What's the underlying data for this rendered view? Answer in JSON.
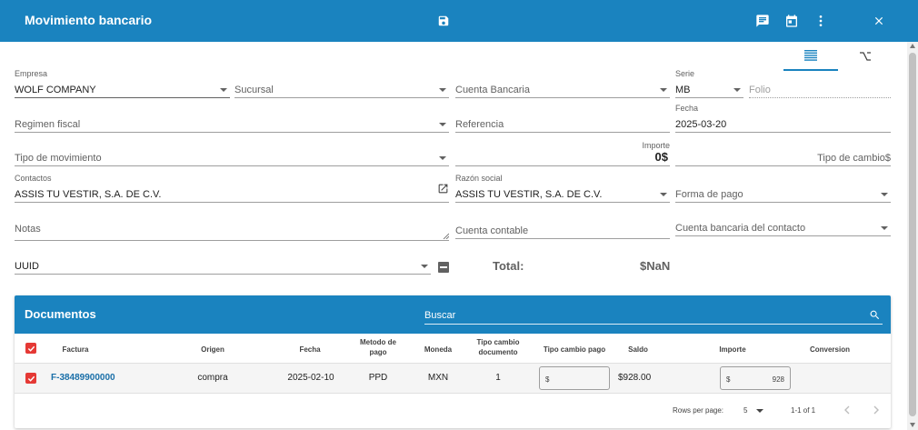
{
  "header": {
    "title": "Movimiento bancario",
    "icons": [
      "save-icon",
      "comment-icon",
      "calendar-icon",
      "more-vert-icon",
      "close-icon"
    ]
  },
  "view_tabs": [
    "list-view-icon",
    "tree-view-icon"
  ],
  "form": {
    "empresa": {
      "label": "Empresa",
      "value": "WOLF COMPANY"
    },
    "sucursal": {
      "placeholder": "Sucursal"
    },
    "cuenta_bancaria": {
      "placeholder": "Cuenta Bancaria"
    },
    "serie": {
      "label": "Serie",
      "value": "MB"
    },
    "folio": {
      "placeholder": "Folio"
    },
    "regimen_fiscal": {
      "placeholder": "Regimen fiscal"
    },
    "referencia": {
      "placeholder": "Referencia"
    },
    "fecha": {
      "label": "Fecha",
      "value": "2025-03-20"
    },
    "tipo_movimiento": {
      "placeholder": "Tipo de movimiento"
    },
    "importe": {
      "label": "Importe",
      "value": "0$"
    },
    "tipo_cambio": {
      "placeholder": "Tipo de cambio$"
    },
    "contactos": {
      "label": "Contactos",
      "value": "ASSIS TU VESTIR, S.A. DE C.V."
    },
    "razon_social": {
      "label": "Razón social",
      "value": "ASSIS TU VESTIR, S.A. DE C.V."
    },
    "forma_pago": {
      "placeholder": "Forma de pago"
    },
    "notas": {
      "placeholder": "Notas"
    },
    "cuenta_contable": {
      "placeholder": "Cuenta contable"
    },
    "cuenta_bancaria_contacto": {
      "placeholder": "Cuenta bancaria del contacto"
    },
    "uuid": {
      "placeholder": "UUID"
    },
    "total_label": "Total:",
    "total_value": "$NaN"
  },
  "documentos": {
    "title": "Documentos",
    "search_placeholder": "Buscar",
    "columns": {
      "factura": "Factura",
      "origen": "Origen",
      "fecha": "Fecha",
      "metodo_l1": "Metodo de",
      "metodo_l2": "pago",
      "moneda": "Moneda",
      "tipo_doc_l1": "Tipo cambio",
      "tipo_doc_l2": "documento",
      "tipo_pago": "Tipo cambio pago",
      "saldo": "Saldo",
      "importe": "Importe",
      "conversion": "Conversion"
    },
    "rows": [
      {
        "factura": "F-38489900000",
        "origen": "compra",
        "fecha": "2025-02-10",
        "metodo": "PPD",
        "moneda": "MXN",
        "tipo_cambio_doc": "1",
        "tipo_cambio_pago_prefix": "$",
        "saldo": "$928.00",
        "importe_prefix": "$",
        "importe": "928"
      }
    ],
    "footer": {
      "rows_per_page_label": "Rows per page:",
      "rows_per_page_value": "5",
      "range": "1-1 of 1"
    }
  },
  "colors": {
    "primary": "#1a83bf",
    "checkbox": "#e53935",
    "link": "#1a6fa8"
  }
}
